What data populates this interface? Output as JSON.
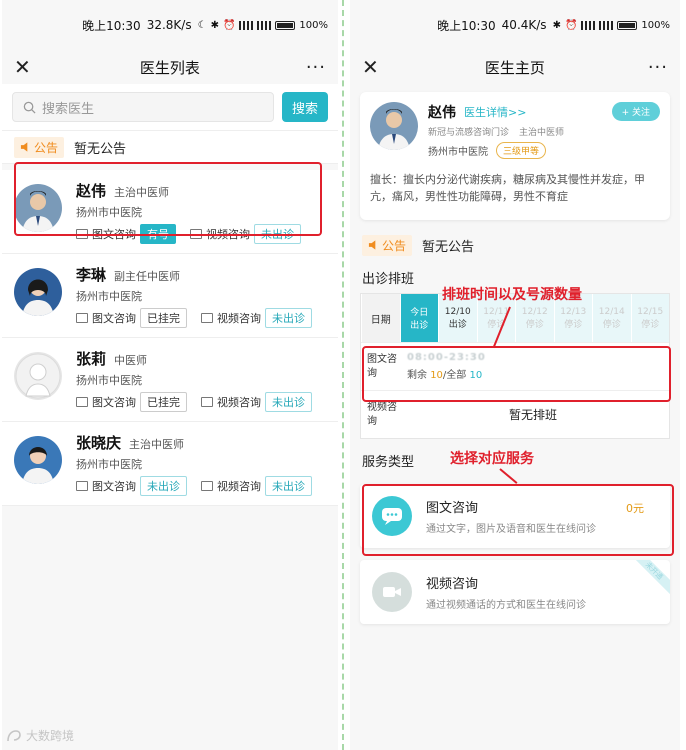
{
  "left": {
    "status": {
      "time": "晚上10:30",
      "speed": "32.8K/s",
      "battery": "100%"
    },
    "nav": {
      "title": "医生列表",
      "more": "···"
    },
    "search": {
      "placeholder": "搜索医生",
      "button": "搜索"
    },
    "notice": {
      "tag": "公告",
      "text": "暂无公告"
    },
    "doctors": [
      {
        "name": "赵伟",
        "title": "主治中医师",
        "hospital": "扬州市中医院",
        "svc1": "图文咨询",
        "svc1_status": "有号",
        "svc2": "视频咨询",
        "svc2_status": "未出诊"
      },
      {
        "name": "李琳",
        "title": "副主任中医师",
        "hospital": "扬州市中医院",
        "svc1": "图文咨询",
        "svc1_status": "已挂完",
        "svc2": "视频咨询",
        "svc2_status": "未出诊"
      },
      {
        "name": "张莉",
        "title": "中医师",
        "hospital": "扬州市中医院",
        "svc1": "图文咨询",
        "svc1_status": "已挂完",
        "svc2": "视频咨询",
        "svc2_status": "未出诊"
      },
      {
        "name": "张晓庆",
        "title": "主治中医师",
        "hospital": "扬州市中医院",
        "svc1": "图文咨询",
        "svc1_status": "未出诊",
        "svc2": "视频咨询",
        "svc2_status": "未出诊"
      }
    ]
  },
  "right": {
    "status": {
      "time": "晚上10:30",
      "speed": "40.4K/s",
      "battery": "100%"
    },
    "nav": {
      "title": "医生主页",
      "more": "···"
    },
    "profile": {
      "name": "赵伟",
      "detail_link": "医生详情>>",
      "clinic": "新冠与流感咨询门诊",
      "title": "主治中医师",
      "hospital": "扬州市中医院",
      "level": "三级甲等",
      "follow": "+ 关注",
      "desc": "擅长：擅长内分泌代谢疾病，糖尿病及其慢性并发症，甲亢，痛风，男性性功能障碍，男性不育症"
    },
    "notice": {
      "tag": "公告",
      "text": "暂无公告"
    },
    "schedule": {
      "title": "出诊排班",
      "head_label": "日期",
      "dates": [
        {
          "d": "今日",
          "s": "出诊"
        },
        {
          "d": "12/10",
          "s": "出诊"
        },
        {
          "d": "12/11",
          "s": "停诊"
        },
        {
          "d": "12/12",
          "s": "停诊"
        },
        {
          "d": "12/13",
          "s": "停诊"
        },
        {
          "d": "12/14",
          "s": "停诊"
        },
        {
          "d": "12/15",
          "s": "停诊"
        }
      ],
      "row1_label": "图文咨询",
      "row1_time": "08:00-23:30",
      "row1_prefix": "剩余 ",
      "row1_left": "10",
      "row1_mid": "/全部 ",
      "row1_total": "10",
      "row2_label": "视频咨询",
      "row2_text": "暂无排班"
    },
    "services": {
      "title": "服务类型",
      "items": [
        {
          "name": "图文咨询",
          "desc": "通过文字，图片及语音和医生在线问诊",
          "price": "0元"
        },
        {
          "name": "视频咨询",
          "desc": "通过视频通话的方式和医生在线问诊",
          "ribbon": "未开通"
        }
      ]
    },
    "annotations": {
      "a1": "排班时间以及号源数量",
      "a2": "选择对应服务"
    }
  },
  "watermark": "大数跨境",
  "colors": {
    "accent": "#26b6c7",
    "highlight": "#e0202c",
    "warn": "#e39a16"
  }
}
